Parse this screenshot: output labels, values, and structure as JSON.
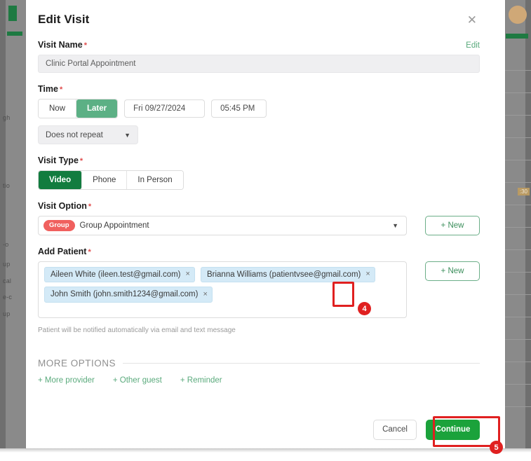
{
  "background": {
    "left_labels": [
      "gh",
      "tio",
      "-o",
      "up",
      "cal",
      "e-c",
      "up"
    ],
    "right_chip": ":30"
  },
  "modal": {
    "title": "Edit Visit",
    "close_icon": "close-icon",
    "visit_name": {
      "label": "Visit Name",
      "required_mark": "*",
      "edit_label": "Edit",
      "value": "Clinic Portal Appointment"
    },
    "time": {
      "label": "Time",
      "required_mark": "*",
      "options": [
        "Now",
        "Later"
      ],
      "selected": "Later",
      "date": "Fri 09/27/2024",
      "time": "05:45 PM",
      "repeat": "Does not repeat",
      "repeat_caret": "chevron-down-icon"
    },
    "visit_type": {
      "label": "Visit Type",
      "required_mark": "*",
      "options": [
        "Video",
        "Phone",
        "In Person"
      ],
      "selected": "Video"
    },
    "visit_option": {
      "label": "Visit Option",
      "required_mark": "*",
      "badge": "Group",
      "value": "Group Appointment",
      "caret": "chevron-down-icon",
      "new_label": "+ New"
    },
    "add_patient": {
      "label": "Add Patient",
      "required_mark": "*",
      "new_label": "+ New",
      "chips": [
        {
          "text": "Aileen White (ileen.test@gmail.com)",
          "remove": "×"
        },
        {
          "text": "Brianna Williams (patientvsee@gmail.com)",
          "remove": "×"
        },
        {
          "text": "John Smith (john.smith1234@gmail.com)",
          "remove": "×"
        }
      ],
      "hint": "Patient will be notified automatically via email and text message"
    },
    "more_options": {
      "title": "MORE OPTIONS",
      "links": [
        "+ More provider",
        "+ Other guest",
        "+ Reminder"
      ]
    },
    "footer": {
      "cancel_label": "Cancel",
      "continue_label": "Continue"
    }
  },
  "annotations": [
    {
      "number": "4",
      "target": "patient-chip-remove"
    },
    {
      "number": "5",
      "target": "continue-button"
    }
  ],
  "colors": {
    "accent_forest": "#127c3f",
    "accent_sage": "#5cb085",
    "accent_bright": "#1ba23b",
    "badge_red": "#f0605e",
    "annotation_red": "#e02020",
    "chip_blue": "#d4eaf7",
    "required_red": "#e04b4b"
  }
}
